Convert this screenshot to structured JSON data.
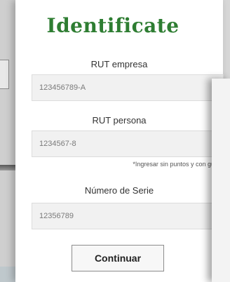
{
  "form": {
    "title": "Identificate",
    "rut_empresa_label": "RUT empresa",
    "rut_empresa_value": "123456789-A",
    "rut_persona_label": "RUT persona",
    "rut_persona_value": "1234567-8",
    "hint": "*Ingresar sin puntos y con guión",
    "serie_label": "Número de Serie",
    "serie_value": "12356789",
    "continue_label": "Continuar"
  }
}
